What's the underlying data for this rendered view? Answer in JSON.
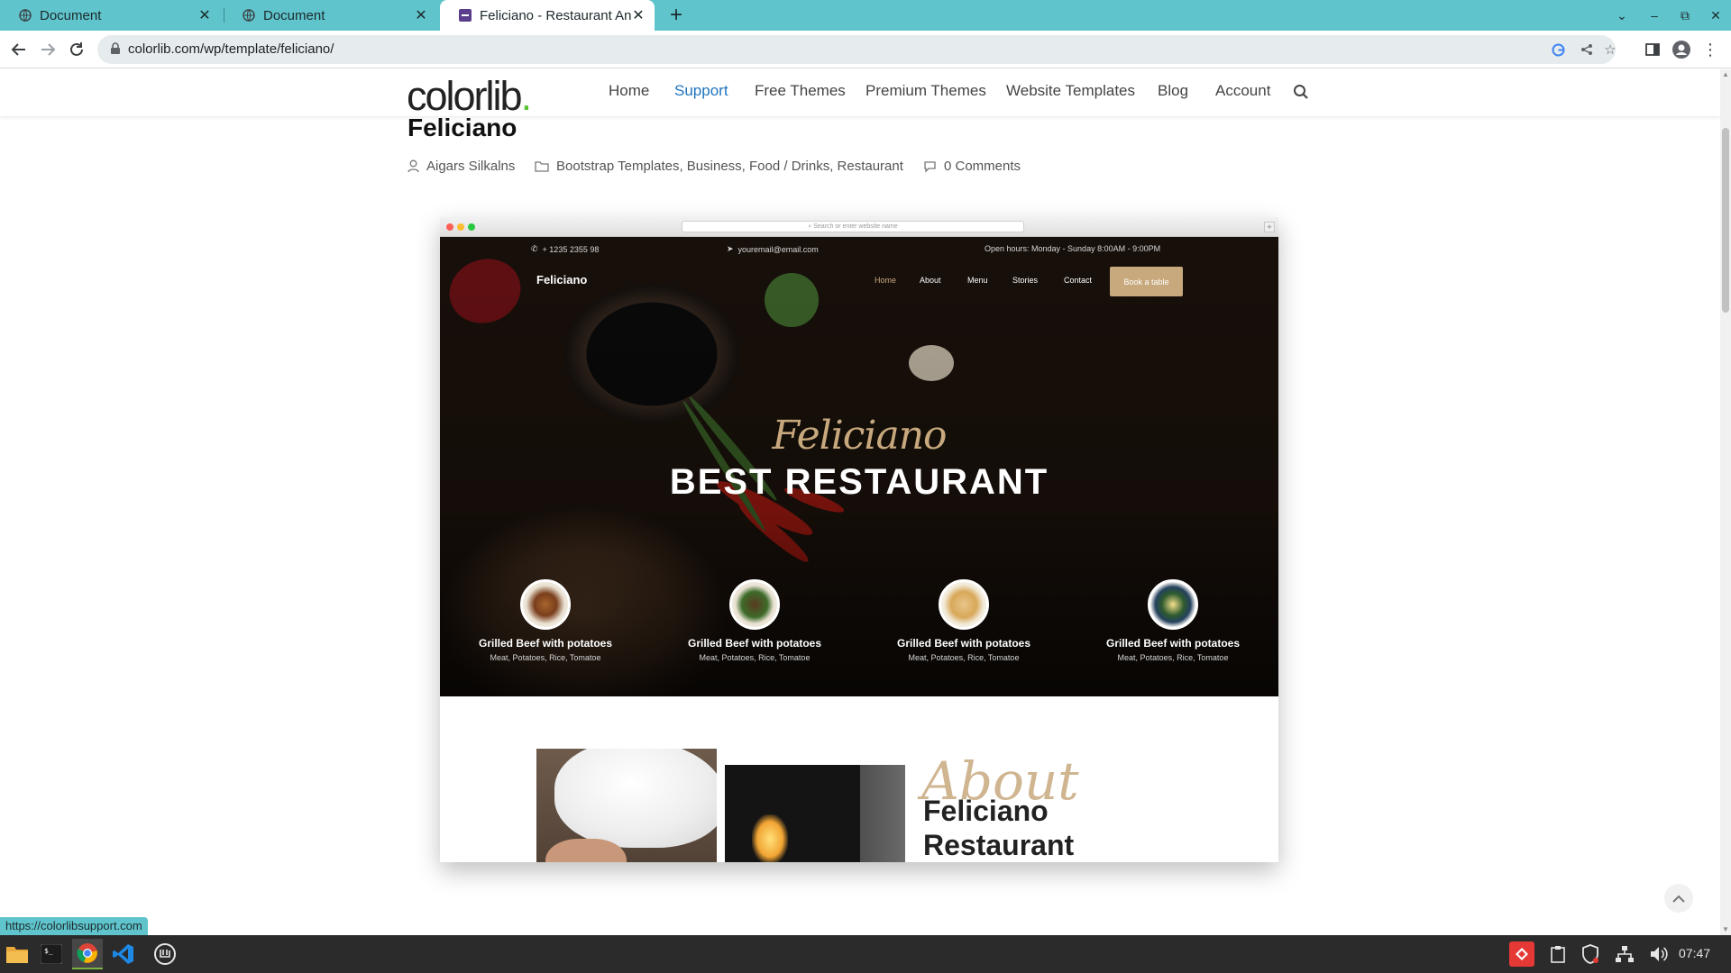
{
  "browser": {
    "tabs": [
      {
        "title": "Document",
        "active": false
      },
      {
        "title": "Document",
        "active": false
      },
      {
        "title": "Feliciano - Restaurant And Ca",
        "active": true
      }
    ],
    "url": "colorlib.com/wp/template/feliciano/",
    "status_url": "https://colorlibsupport.com"
  },
  "site": {
    "logo": "colorlib",
    "logo_dot": ".",
    "nav": [
      "Home",
      "Support",
      "Free Themes",
      "Premium Themes",
      "Website Templates",
      "Blog",
      "Account"
    ],
    "active_nav": "Support"
  },
  "post": {
    "title": "Feliciano",
    "author": "Aigars Silkalns",
    "categories": "Bootstrap Templates, Business, Food / Drinks, Restaurant",
    "comments": "0 Comments"
  },
  "preview": {
    "mac_url_placeholder": "Search or enter website name",
    "phone": "+ 1235 2355 98",
    "email": "youremail@email.com",
    "hours": "Open hours: Monday - Sunday 8:00AM - 9:00PM",
    "brand": "Feliciano",
    "nav": [
      "Home",
      "About",
      "Menu",
      "Stories",
      "Contact"
    ],
    "book_button": "Book a table",
    "script_title": "Feliciano",
    "heading": "BEST RESTAURANT",
    "dishes": [
      {
        "name": "Grilled Beef with potatoes",
        "ingredients": "Meat, Potatoes, Rice, Tomatoe"
      },
      {
        "name": "Grilled Beef with potatoes",
        "ingredients": "Meat, Potatoes, Rice, Tomatoe"
      },
      {
        "name": "Grilled Beef with potatoes",
        "ingredients": "Meat, Potatoes, Rice, Tomatoe"
      },
      {
        "name": "Grilled Beef with potatoes",
        "ingredients": "Meat, Potatoes, Rice, Tomatoe"
      }
    ],
    "about_script": "About",
    "about_heading_line1": "Feliciano",
    "about_heading_line2": "Restaurant"
  },
  "taskbar": {
    "clock": "07:47"
  },
  "colors": {
    "tab_strip": "#5fc4cc",
    "nav_active": "#1e73be",
    "gold_accent": "#c8a97e",
    "logo_dot": "#5bc236"
  }
}
